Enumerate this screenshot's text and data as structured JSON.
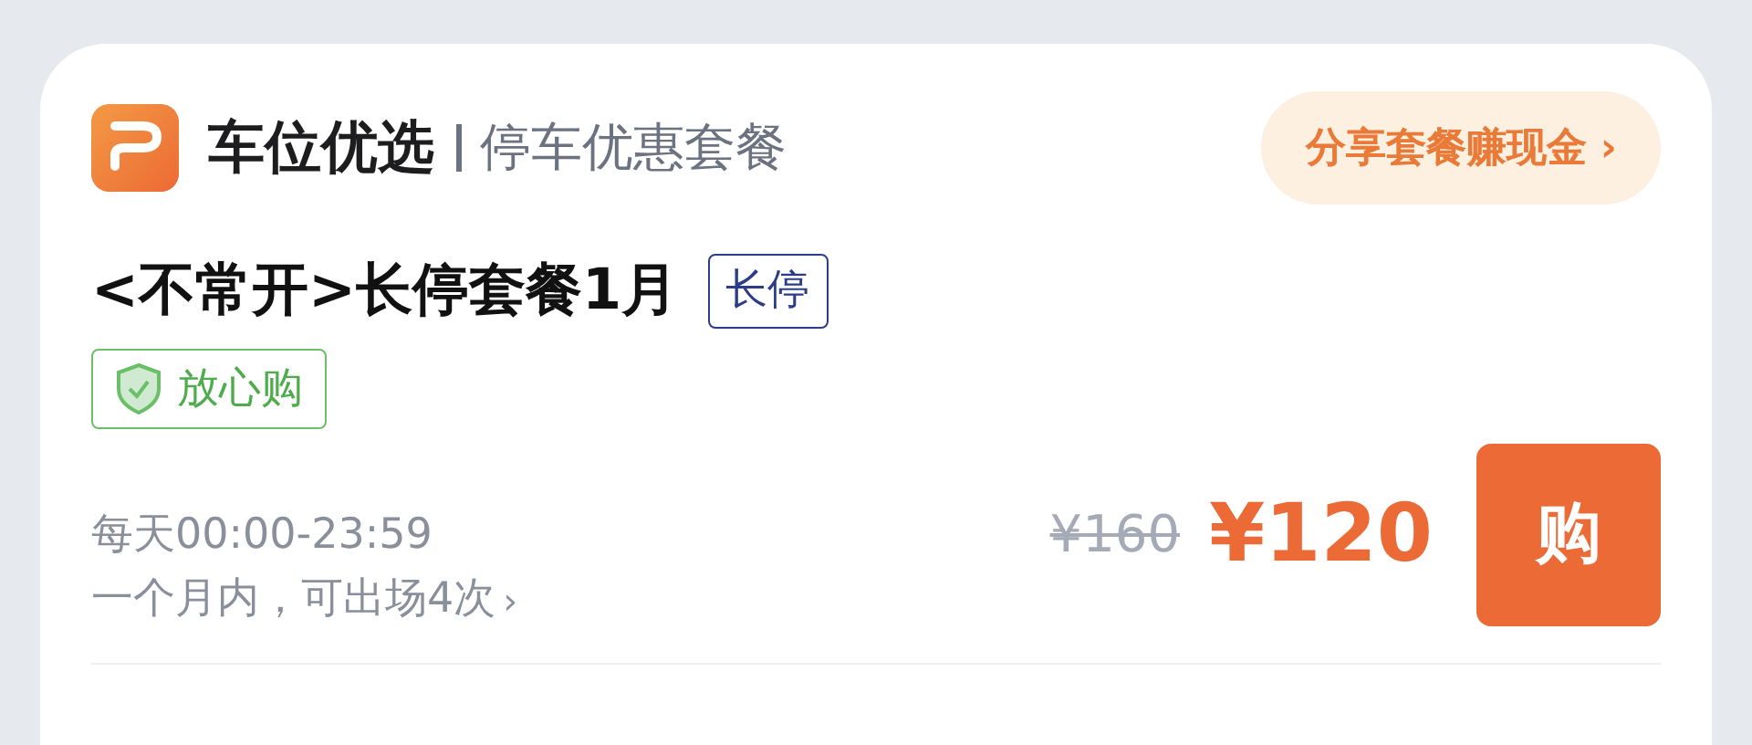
{
  "header": {
    "brand": "车位优选",
    "subtitle": "停车优惠套餐",
    "share_button": {
      "label": "分享套餐赚现金",
      "chevron": "›"
    }
  },
  "package": {
    "title": "<不常开>长停套餐1月",
    "tag": "长停",
    "guarantee_badge": "放心购",
    "hours": "每天00:00-23:59",
    "exit_rule": {
      "text": "一个月内，可出场4次",
      "chevron": "›"
    },
    "original_price": "¥160",
    "price": "¥120",
    "buy_button": "购"
  }
}
